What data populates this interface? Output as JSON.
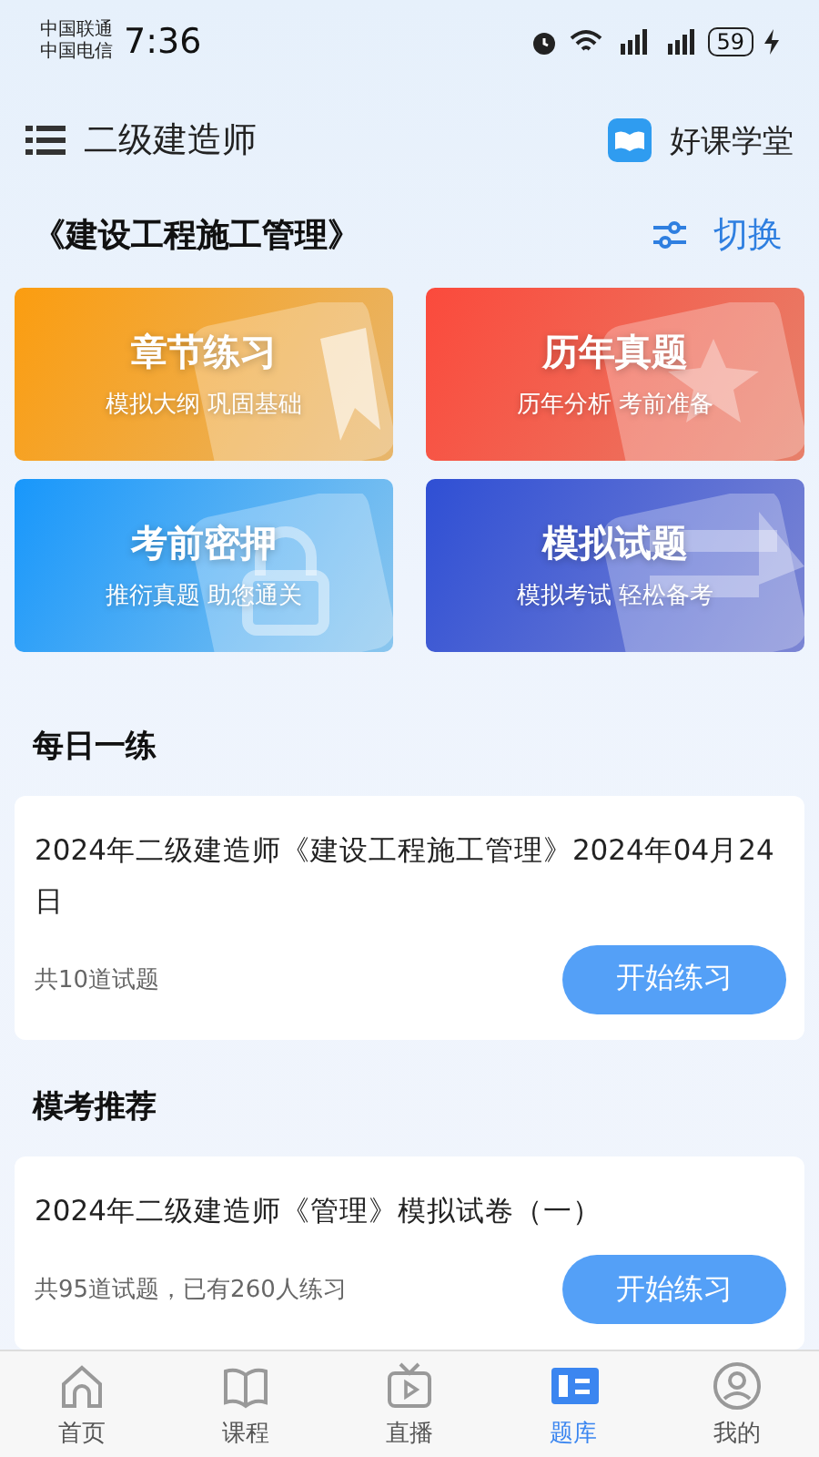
{
  "status_bar": {
    "carriers": [
      "中国联通",
      "中国电信"
    ],
    "time": "7:36",
    "battery": "59"
  },
  "header": {
    "title": "二级建造师",
    "brand": "好课学堂"
  },
  "subject": {
    "title": "《建设工程施工管理》",
    "switch_label": "切换"
  },
  "tiles": [
    {
      "title": "章节练习",
      "subtitle": "模拟大纲 巩固基础",
      "kind": "bookmark"
    },
    {
      "title": "历年真题",
      "subtitle": "历年分析 考前准备",
      "kind": "star"
    },
    {
      "title": "考前密押",
      "subtitle": "推衍真题 助您通关",
      "kind": "lock"
    },
    {
      "title": "模拟试题",
      "subtitle": "模拟考试 轻松备考",
      "kind": "paper"
    }
  ],
  "daily": {
    "heading": "每日一练",
    "title": "2024年二级建造师《建设工程施工管理》2024年04月24日",
    "meta": "共10道试题",
    "button": "开始练习"
  },
  "recommend": {
    "heading": "模考推荐",
    "title": "2024年二级建造师《管理》模拟试卷（一）",
    "meta": "共95道试题，已有260人练习",
    "button": "开始练习"
  },
  "tab_bar": [
    {
      "label": "首页",
      "kind": "home",
      "selected": false
    },
    {
      "label": "课程",
      "kind": "book",
      "selected": false
    },
    {
      "label": "直播",
      "kind": "tv",
      "selected": false
    },
    {
      "label": "题库",
      "kind": "bank",
      "selected": true
    },
    {
      "label": "我的",
      "kind": "user",
      "selected": false
    }
  ]
}
